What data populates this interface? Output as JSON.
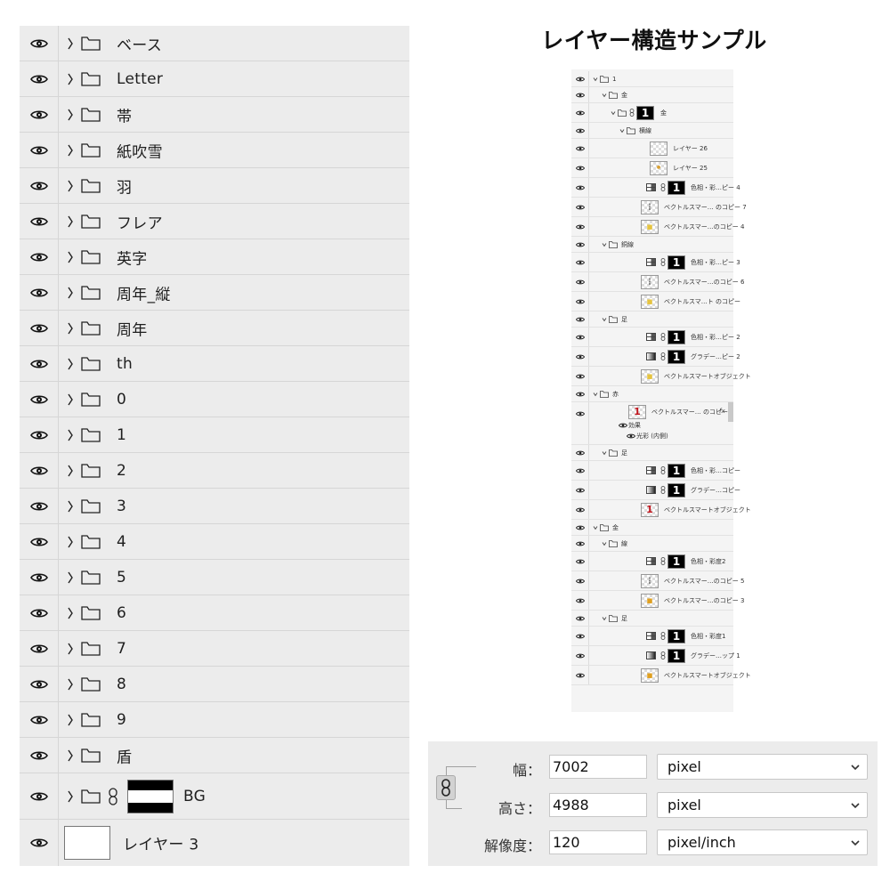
{
  "big_panel": {
    "folders": [
      "ベース",
      "Letter",
      "帯",
      "紙吹雪",
      "羽",
      "フレア",
      "英字",
      "周年_縦",
      "周年",
      "th",
      "0",
      "1",
      "2",
      "3",
      "4",
      "5",
      "6",
      "7",
      "8",
      "9",
      "盾"
    ],
    "bg_group": {
      "label": "BG",
      "icons": [
        "eye-icon",
        "chevron-right-icon",
        "folder-icon",
        "link-icon",
        "mask-thumbnail"
      ]
    },
    "last_layer": {
      "label": "レイヤー 3"
    }
  },
  "sample": {
    "title": "レイヤー構造サンプル",
    "rows": [
      {
        "kind": "group",
        "indent": 0,
        "label": "1",
        "open": true
      },
      {
        "kind": "group",
        "indent": 1,
        "label": "金",
        "open": true
      },
      {
        "kind": "group-mask",
        "indent": 2,
        "label": "金",
        "open": true
      },
      {
        "kind": "group",
        "indent": 3,
        "label": "横線",
        "open": true
      },
      {
        "kind": "thumb",
        "indent": 4,
        "label": "レイヤー 26",
        "glyph": ""
      },
      {
        "kind": "thumb",
        "indent": 4,
        "label": "レイヤー 25",
        "glyph": "•",
        "color": "#d8a030"
      },
      {
        "kind": "adj",
        "adj": "hue",
        "indent": 3,
        "label": "色相・彩…ピー 4"
      },
      {
        "kind": "thumb",
        "indent": 3,
        "label": "ベクトルスマー… のコピー 7",
        "glyph": "⁝",
        "color": "#888888"
      },
      {
        "kind": "thumb",
        "indent": 3,
        "label": "ベクトルスマー…のコピー 4",
        "glyph": "▪",
        "color": "#e6c440"
      },
      {
        "kind": "group",
        "indent": 1,
        "label": "銅線",
        "open": true
      },
      {
        "kind": "adj",
        "adj": "hue",
        "indent": 3,
        "label": "色相・彩…ピー 3"
      },
      {
        "kind": "thumb",
        "indent": 3,
        "label": "ベクトルスマー…のコピー 6",
        "glyph": "⁝",
        "color": "#888888"
      },
      {
        "kind": "thumb",
        "indent": 3,
        "label": "ベクトルスマ…ト のコピー",
        "glyph": "▪",
        "color": "#e6c440"
      },
      {
        "kind": "group",
        "indent": 1,
        "label": "足",
        "open": true
      },
      {
        "kind": "adj",
        "adj": "hue",
        "indent": 3,
        "label": "色相・彩…ピー 2"
      },
      {
        "kind": "adj",
        "adj": "grad",
        "indent": 3,
        "label": "グラデー…ピー 2"
      },
      {
        "kind": "thumb",
        "indent": 3,
        "label": "ベクトルスマートオブジェクト",
        "glyph": "▪",
        "color": "#e6c440"
      },
      {
        "kind": "group",
        "indent": 0,
        "label": "赤",
        "open": true
      },
      {
        "kind": "fx",
        "indent": 2,
        "label": "ベクトルスマー… のコピー 2",
        "glyph": "1",
        "color": "#c0141c",
        "fx": "fx",
        "effects_label": "効果",
        "effect_item": "光彩 (内側)"
      },
      {
        "kind": "group",
        "indent": 1,
        "label": "足",
        "open": true
      },
      {
        "kind": "adj",
        "adj": "hue",
        "indent": 3,
        "label": "色相・彩…コピー"
      },
      {
        "kind": "adj",
        "adj": "grad",
        "indent": 3,
        "label": "グラデー…コピー"
      },
      {
        "kind": "thumb",
        "indent": 3,
        "label": "ベクトルスマートオブジェクト",
        "glyph": "1",
        "color": "#c0141c"
      },
      {
        "kind": "group",
        "indent": 0,
        "label": "金",
        "open": true
      },
      {
        "kind": "group",
        "indent": 1,
        "label": "線",
        "open": true
      },
      {
        "kind": "adj",
        "adj": "hue",
        "indent": 3,
        "label": "色相・彩度2"
      },
      {
        "kind": "thumb",
        "indent": 3,
        "label": "ベクトルスマー…のコピー 5",
        "glyph": "⁝",
        "color": "#888888"
      },
      {
        "kind": "thumb",
        "indent": 3,
        "label": "ベクトルスマー…のコピー 3",
        "glyph": "▪",
        "color": "#e0a020"
      },
      {
        "kind": "group",
        "indent": 1,
        "label": "足",
        "open": true
      },
      {
        "kind": "adj",
        "adj": "hue",
        "indent": 3,
        "label": "色相・彩度1"
      },
      {
        "kind": "adj",
        "adj": "grad",
        "indent": 3,
        "label": "グラデー…ップ 1"
      },
      {
        "kind": "thumb",
        "indent": 3,
        "label": "ベクトルスマートオブジェクト",
        "glyph": "▪",
        "color": "#e0a020"
      }
    ]
  },
  "size_panel": {
    "width_label": "幅：",
    "width_value": "7002",
    "width_unit": "pixel",
    "height_label": "高さ：",
    "height_value": "4988",
    "height_unit": "pixel",
    "resolution_label": "解像度：",
    "resolution_value": "120",
    "resolution_unit": "pixel/inch"
  }
}
